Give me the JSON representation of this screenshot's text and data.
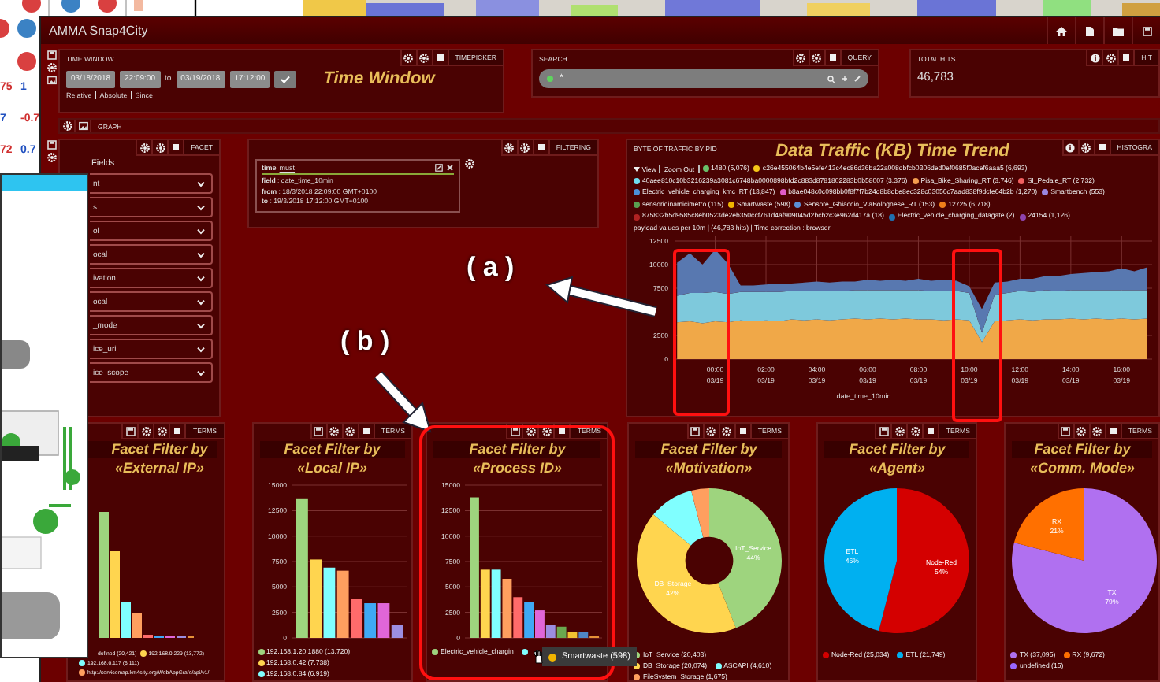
{
  "background_table": {
    "cells": [
      "75",
      "1",
      "7",
      "-0.7",
      "72",
      "0.7"
    ]
  },
  "window": {
    "title": "AMMA Snap4City"
  },
  "time_window": {
    "label": "TIME WINDOW",
    "tag": "TIMEPICKER",
    "from_date": "03/18/2018",
    "from_time": "22:09:00",
    "to_label": "to",
    "to_date": "03/19/2018",
    "to_time": "17:12:00",
    "title": "Time Window",
    "modes": [
      "Relative",
      "Absolute",
      "Since"
    ]
  },
  "search": {
    "label": "SEARCH",
    "tag": "QUERY",
    "value": "*"
  },
  "total_hits": {
    "label": "TOTAL HITS",
    "tag": "HIT",
    "value": "46,783"
  },
  "graph": {
    "label": "GRAPH"
  },
  "facet": {
    "tag": "FACET",
    "heading": "Fields",
    "fields": [
      "nt",
      "s",
      "ol",
      "ocal",
      "ivation",
      "ocal",
      "_mode",
      "ice_uri",
      "ice_scope"
    ]
  },
  "filtering": {
    "tag": "FILTERING",
    "name": "time",
    "op": "must",
    "lines": [
      "**field** : date_time_10min",
      "**from** : 18/3/2018 22:09:00 GMT+0100",
      "**to** : 19/3/2018 17:12:00 GMT+0100"
    ]
  },
  "traffic": {
    "label": "BYTE OF TRAFFIC BY PID",
    "title": "Data Traffic (KB) Time Trend",
    "tag": "HISTOGRA",
    "view": "View",
    "zoom_out": "Zoom Out",
    "legend": [
      {
        "label": "1480 (5,076)",
        "color": "#6abf69"
      },
      {
        "label": "c26e455064b4e5efe413c4ec86d36ba22a008dbfcb0306ded0ef0685f0acef6aaa5 (6,693)",
        "color": "#f5c518"
      },
      {
        "label": "40aee810c10b3216239a3081c6748ba0000898bfd2c883d8781802283b0b58007 (3,376)",
        "color": "#6fdcf0"
      },
      {
        "label": "Pisa_Bike_Sharing_RT (3,746)",
        "color": "#f39c4f"
      },
      {
        "label": "SI_Pedale_RT (2,732)",
        "color": "#f26060"
      },
      {
        "label": "Electric_vehicle_charging_kmc_RT (13,847)",
        "color": "#4a90d9"
      },
      {
        "label": "b8ae048c0c098bb0f8f7f7b24d8b8dbe8ec328c03056c7aad838f9dcfe64b2b (1,270)",
        "color": "#e05cc8"
      },
      {
        "label": "Smartbench (553)",
        "color": "#9a87e0"
      },
      {
        "label": "sensoridinamicimetro (115)",
        "color": "#5aa050"
      },
      {
        "label": "Smartwaste (598)",
        "color": "#f0b400"
      },
      {
        "label": "Sensore_Ghiaccio_ViaBolognese_RT (153)",
        "color": "#5b8fd6"
      },
      {
        "label": "12725 (6,718)",
        "color": "#f07f1a"
      },
      {
        "label": "875832b5d9585c8eb0523de2eb350ccf761d4af909045d2bcb2c3e962d417a (18)",
        "color": "#b22222"
      },
      {
        "label": "Electric_vehicle_charging_datagate (2)",
        "color": "#2070b0"
      },
      {
        "label": "24154 (1,126)",
        "color": "#8e44ad"
      }
    ],
    "note": "payload values per 10m | (46,783 hits) | Time correction : browser",
    "date_labels": [
      "03/19",
      "03/19",
      "03/19",
      "03/19",
      "03/19",
      "03/19",
      "03/19",
      "03/19",
      "03/19"
    ],
    "chart_data": {
      "type": "area",
      "stacked": true,
      "grid": true,
      "xlabel": "date_time_10min",
      "xlim": [
        -1.6,
        17.2
      ],
      "ylim": [
        0,
        13000
      ],
      "x": [
        -1.5,
        -1,
        -0.5,
        0,
        0.5,
        1,
        1.5,
        2,
        2.5,
        3,
        3.5,
        4,
        4.5,
        5,
        5.5,
        6,
        6.5,
        7,
        7.5,
        8,
        8.5,
        9,
        9.5,
        10,
        10.5,
        11,
        11.5,
        12,
        12.5,
        13,
        13.5,
        14,
        14.5,
        15,
        15.5,
        16,
        16.5,
        17
      ],
      "yticks": [
        0,
        2500,
        7500,
        10000,
        12500
      ],
      "xticks": [
        {
          "value": 0,
          "label": "00:00"
        },
        {
          "value": 2,
          "label": "02:00"
        },
        {
          "value": 4,
          "label": "04:00"
        },
        {
          "value": 6,
          "label": "06:00"
        },
        {
          "value": 8,
          "label": "08:00"
        },
        {
          "value": 10,
          "label": "10:00"
        },
        {
          "value": 12,
          "label": "12:00"
        },
        {
          "value": 14,
          "label": "14:00"
        },
        {
          "value": 16,
          "label": "16:00"
        }
      ],
      "series": [
        {
          "color": "#f0a848",
          "values": [
            3900,
            4000,
            3800,
            4000,
            3900,
            4100,
            4000,
            4100,
            4000,
            4200,
            4100,
            4200,
            4100,
            4200,
            4300,
            4200,
            4300,
            4200,
            4300,
            4200,
            4200,
            4100,
            4200,
            4100,
            1800,
            4000,
            4100,
            4200,
            4100,
            4200,
            4200,
            4300,
            4200,
            4300,
            4200,
            4300,
            4200,
            4300
          ]
        },
        {
          "color": "#7ec9dc",
          "values": [
            2800,
            3000,
            3200,
            3100,
            3000,
            3000,
            3100,
            3000,
            3100,
            3000,
            3100,
            3000,
            3100,
            3000,
            3000,
            3100,
            3000,
            3100,
            3000,
            3100,
            3000,
            3100,
            3000,
            2900,
            1000,
            2800,
            2900,
            3000,
            3000,
            3100,
            3000,
            3000,
            3100,
            3000,
            3100,
            3000,
            3100,
            3000
          ]
        },
        {
          "color": "#5878b0",
          "values": [
            3500,
            4200,
            3000,
            4500,
            3200,
            700,
            700,
            800,
            900,
            800,
            900,
            1000,
            900,
            1000,
            900,
            1100,
            1000,
            1100,
            1000,
            1200,
            1100,
            1200,
            1100,
            700,
            2500,
            1300,
            1200,
            1300,
            1400,
            1500,
            1600,
            1700,
            1800,
            1900,
            2000,
            2300,
            2000,
            2400
          ]
        }
      ]
    }
  },
  "facet_panels": [
    {
      "kind": "bars_picture",
      "tag": "TERMS",
      "title": "Facet Filter by",
      "subtitle": "«External IP»",
      "legend": [
        {
          "label": "defined (20,421)"
        },
        {
          "label": "192.168.0.229 (13,772)",
          "color": "#ffd54f"
        },
        {
          "label": "192.168.0.117 (6,111)",
          "color": "#80ffff"
        },
        {
          "label": "http://servicemap.km4city.org/WebAppGrafo/api/v1/",
          "color": "#ff9f5f"
        }
      ]
    },
    {
      "kind": "bar",
      "tag": "TERMS",
      "title": "Facet Filter by",
      "subtitle": "«Local IP»",
      "legend": [
        {
          "label": "192.168.1.20:1880 (13,720)",
          "color": "#9ed47e"
        },
        {
          "label": "192.168.0.42 (7,738)",
          "color": "#ffd54f"
        },
        {
          "label": "192.168.0.84 (6,919)",
          "color": "#80ffff"
        }
      ],
      "chart_data": {
        "type": "bar",
        "grid": true,
        "ylim": [
          0,
          15000
        ],
        "yticks": [
          0,
          2500,
          5000,
          7500,
          10000,
          12500,
          15000
        ],
        "values": [
          13700,
          7700,
          6900,
          6600,
          3800,
          3400,
          3400,
          1300
        ],
        "colors": [
          "#9ed47e",
          "#ffd54f",
          "#80ffff",
          "#ff9f5f",
          "#ff6b6b",
          "#3fa9f5",
          "#e066d8",
          "#9c8ee0"
        ]
      }
    },
    {
      "kind": "bar",
      "tag": "TERMS",
      "title": "Facet Filter by",
      "subtitle": "«Process ID»",
      "legend": [
        {
          "label": "Electric_vehicle_chargin",
          "color": "#9ed47e"
        },
        {
          "color": "#80ffff"
        }
      ],
      "chart_data": {
        "type": "bar",
        "grid": true,
        "ylim": [
          0,
          15000
        ],
        "yticks": [
          0,
          2500,
          5000,
          7500,
          10000,
          12500,
          15000
        ],
        "values": [
          13800,
          6700,
          6700,
          5800,
          4000,
          3500,
          2700,
          1300,
          1100,
          600,
          600,
          200
        ],
        "colors": [
          "#9ed47e",
          "#ffd54f",
          "#80ffff",
          "#ff9f5f",
          "#ff6b6b",
          "#3fa9f5",
          "#e066d8",
          "#9c8ee0",
          "#6aa84f",
          "#f1c232",
          "#4f86c6",
          "#e69138"
        ]
      }
    },
    {
      "kind": "donut",
      "tag": "TERMS",
      "title": "Facet Filter by",
      "subtitle": "«Motivation»",
      "legend": [
        {
          "label": "IoT_Service (20,403)",
          "color": "#9ed47e"
        },
        {
          "label": "DB_Storage (20,074)",
          "color": "#ffd54f"
        },
        {
          "label": "ASCAPI (4,610)",
          "color": "#80ffff"
        },
        {
          "label": "FileSystem_Storage (1,675)",
          "color": "#ff9f5f"
        }
      ],
      "slice_labels": [
        {
          "name": "IoT_Service",
          "share": "44%"
        },
        {
          "name": "DB_Storage",
          "share": "42%"
        }
      ],
      "chart_data": {
        "type": "donut",
        "values": [
          44,
          42,
          10,
          4
        ]
      }
    },
    {
      "kind": "pie",
      "tag": "TERMS",
      "title": "Facet Filter by",
      "subtitle": "«Agent»",
      "legend": [
        {
          "label": "Node-Red (25,034)",
          "color": "#d40000"
        },
        {
          "label": "ETL (21,749)",
          "color": "#00b0f0"
        }
      ],
      "slice_labels": [
        {
          "name": "Node-Red",
          "share": "54%"
        },
        {
          "name": "ETL",
          "share": "46%"
        }
      ],
      "chart_data": {
        "type": "pie",
        "values": [
          54,
          46
        ]
      }
    },
    {
      "kind": "pie",
      "tag": "TERMS",
      "title": "Facet Filter by",
      "subtitle": "«Comm. Mode»",
      "legend": [
        {
          "label": "TX (37,095)",
          "color": "#b070f0"
        },
        {
          "label": "RX (9,672)",
          "color": "#ff7000"
        },
        {
          "label": "undefined (15)",
          "color": "#9966ff"
        }
      ],
      "slice_labels": [
        {
          "name": "TX",
          "share": "79%"
        },
        {
          "name": "RX",
          "share": "21%"
        }
      ],
      "chart_data": {
        "type": "pie",
        "values": [
          79,
          21
        ]
      }
    }
  ],
  "tooltip": {
    "text": "Smartwaste (598)",
    "color": "#f0b400"
  },
  "annotations": [
    {
      "text": "( a )"
    },
    {
      "text": "( b )"
    }
  ]
}
